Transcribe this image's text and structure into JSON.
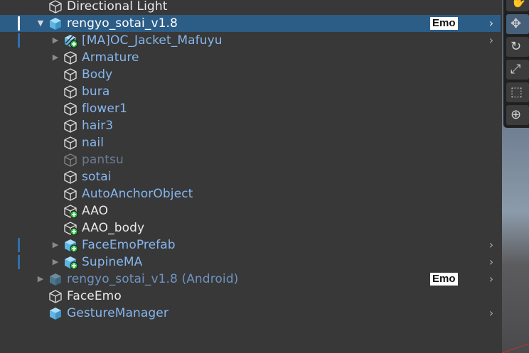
{
  "hierarchy": {
    "items": [
      {
        "label": "Directional Light",
        "indent": 0,
        "fold": "",
        "icon": "gameobject-icon",
        "color": "white",
        "selected": false,
        "bar": "",
        "emo": "",
        "chevron": false
      },
      {
        "label": "rengyo_sotai_v1.8",
        "indent": 0,
        "fold": "▼",
        "icon": "prefab-icon",
        "color": "white",
        "selected": true,
        "bar": "white",
        "emo": "Emo",
        "chevron": true
      },
      {
        "label": "[MA]OC_Jacket_Mafuyu",
        "indent": 1,
        "fold": "▶",
        "icon": "prefab-variant-add-icon",
        "color": "blue",
        "selected": false,
        "bar": "blue",
        "emo": "",
        "chevron": true
      },
      {
        "label": "Armature",
        "indent": 1,
        "fold": "▶",
        "icon": "gameobject-icon",
        "color": "blue",
        "selected": false,
        "bar": "",
        "emo": "",
        "chevron": false
      },
      {
        "label": "Body",
        "indent": 1,
        "fold": "",
        "icon": "gameobject-icon",
        "color": "blue",
        "selected": false,
        "bar": "",
        "emo": "",
        "chevron": false
      },
      {
        "label": "bura",
        "indent": 1,
        "fold": "",
        "icon": "gameobject-icon",
        "color": "blue",
        "selected": false,
        "bar": "",
        "emo": "",
        "chevron": false
      },
      {
        "label": "flower1",
        "indent": 1,
        "fold": "",
        "icon": "gameobject-icon",
        "color": "blue",
        "selected": false,
        "bar": "",
        "emo": "",
        "chevron": false
      },
      {
        "label": "hair3",
        "indent": 1,
        "fold": "",
        "icon": "gameobject-icon",
        "color": "blue",
        "selected": false,
        "bar": "",
        "emo": "",
        "chevron": false
      },
      {
        "label": "nail",
        "indent": 1,
        "fold": "",
        "icon": "gameobject-icon",
        "color": "blue",
        "selected": false,
        "bar": "",
        "emo": "",
        "chevron": false
      },
      {
        "label": "pantsu",
        "indent": 1,
        "fold": "",
        "icon": "gameobject-inactive-icon",
        "color": "dim",
        "selected": false,
        "bar": "",
        "emo": "",
        "chevron": false
      },
      {
        "label": "sotai",
        "indent": 1,
        "fold": "",
        "icon": "gameobject-icon",
        "color": "blue",
        "selected": false,
        "bar": "",
        "emo": "",
        "chevron": false
      },
      {
        "label": "AutoAnchorObject",
        "indent": 1,
        "fold": "",
        "icon": "gameobject-icon",
        "color": "blue",
        "selected": false,
        "bar": "",
        "emo": "",
        "chevron": false
      },
      {
        "label": "AAO",
        "indent": 1,
        "fold": "",
        "icon": "gameobject-add-icon",
        "color": "white",
        "selected": false,
        "bar": "",
        "emo": "",
        "chevron": false
      },
      {
        "label": "AAO_body",
        "indent": 1,
        "fold": "",
        "icon": "gameobject-add-icon",
        "color": "white",
        "selected": false,
        "bar": "",
        "emo": "",
        "chevron": false
      },
      {
        "label": "FaceEmoPrefab",
        "indent": 1,
        "fold": "▶",
        "icon": "prefab-add-icon",
        "color": "blue",
        "selected": false,
        "bar": "blue",
        "emo": "",
        "chevron": true
      },
      {
        "label": "SupineMA",
        "indent": 1,
        "fold": "▶",
        "icon": "prefab-add-icon",
        "color": "blue",
        "selected": false,
        "bar": "blue",
        "emo": "",
        "chevron": true
      },
      {
        "label": "rengyo_sotai_v1.8 (Android)",
        "indent": 0,
        "fold": "▶",
        "icon": "prefab-inactive-icon",
        "color": "dimblue",
        "selected": false,
        "bar": "",
        "emo": "Emo",
        "chevron": true
      },
      {
        "label": "FaceEmo",
        "indent": 0,
        "fold": "",
        "icon": "gameobject-icon",
        "color": "white",
        "selected": false,
        "bar": "",
        "emo": "",
        "chevron": false
      },
      {
        "label": "GestureManager",
        "indent": 0,
        "fold": "",
        "icon": "prefab-icon",
        "color": "blue",
        "selected": false,
        "bar": "",
        "emo": "",
        "chevron": true
      }
    ]
  },
  "toolbar": {
    "tools": [
      {
        "name": "hand-tool-icon",
        "glyph": "✋",
        "active": false
      },
      {
        "name": "move-tool-icon",
        "glyph": "✥",
        "active": true
      },
      {
        "name": "rotate-tool-icon",
        "glyph": "↻",
        "active": false
      },
      {
        "name": "scale-tool-icon",
        "glyph": "⤢",
        "active": false
      },
      {
        "name": "rect-tool-icon",
        "glyph": "⬚",
        "active": false
      },
      {
        "name": "transform-tool-icon",
        "glyph": "⊕",
        "active": false
      }
    ]
  },
  "colors": {
    "background": "#383838",
    "selection": "#2c5d87",
    "prefab_text": "#86b6ee",
    "prefab_icon": "#6fc1ea",
    "add_badge": "#2fbf3f"
  }
}
